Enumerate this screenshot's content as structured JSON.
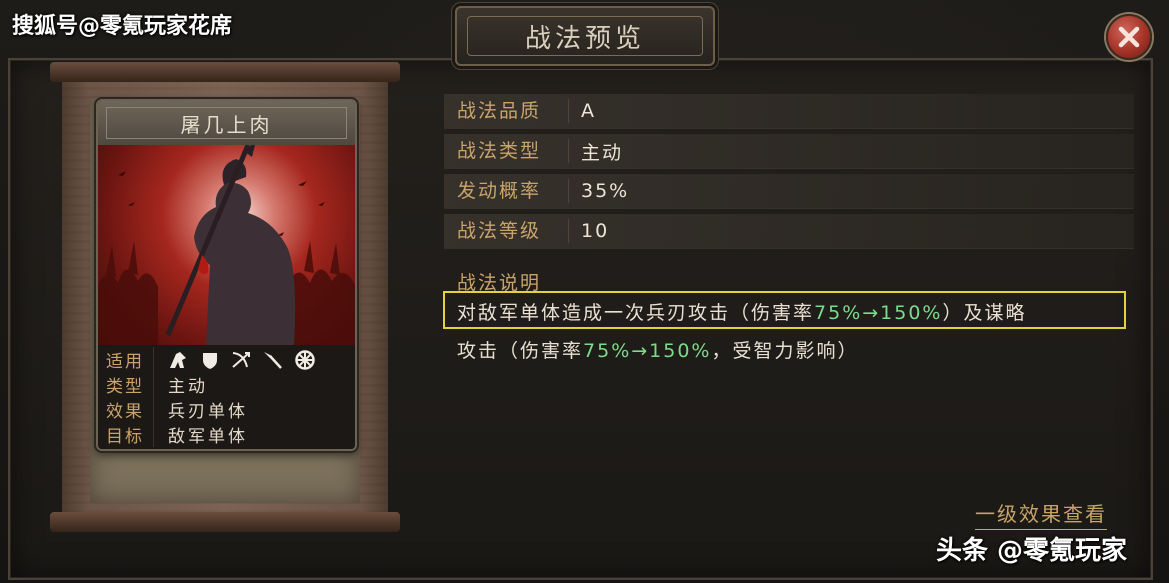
{
  "watermark": "搜狐号@零氪玩家花席",
  "dialog": {
    "title": "战法预览"
  },
  "skill_card": {
    "name": "屠几上肉",
    "info": [
      {
        "label": "适用",
        "icons": [
          "cavalry-icon",
          "shield-icon",
          "archer-icon",
          "spear-icon",
          "siege-icon"
        ]
      },
      {
        "label": "类型",
        "value": "主动"
      },
      {
        "label": "效果",
        "value": "兵刃单体"
      },
      {
        "label": "目标",
        "value": "敌军单体"
      }
    ]
  },
  "attributes": [
    {
      "label": "战法品质",
      "value": "A"
    },
    {
      "label": "战法类型",
      "value": "主动"
    },
    {
      "label": "发动概率",
      "value": "35%"
    },
    {
      "label": "战法等级",
      "value": "10"
    }
  ],
  "description": {
    "heading": "战法说明",
    "line1": {
      "prefix": "对敌军单体造成一次兵刃攻击（伤害率",
      "highlight": "75%→150%",
      "suffix": "）及谋略"
    },
    "line2": {
      "prefix": "攻击（伤害率",
      "highlight": "75%→150%",
      "suffix": "，受智力影响）"
    }
  },
  "detail_link": "一级效果查看",
  "footer_watermark": "头条 @零氪玩家",
  "colors": {
    "gold_label": "#c9a46a",
    "highlight_green": "#7ddc8a",
    "highlight_box": "#e3d23a",
    "close_red": "#a53327"
  }
}
